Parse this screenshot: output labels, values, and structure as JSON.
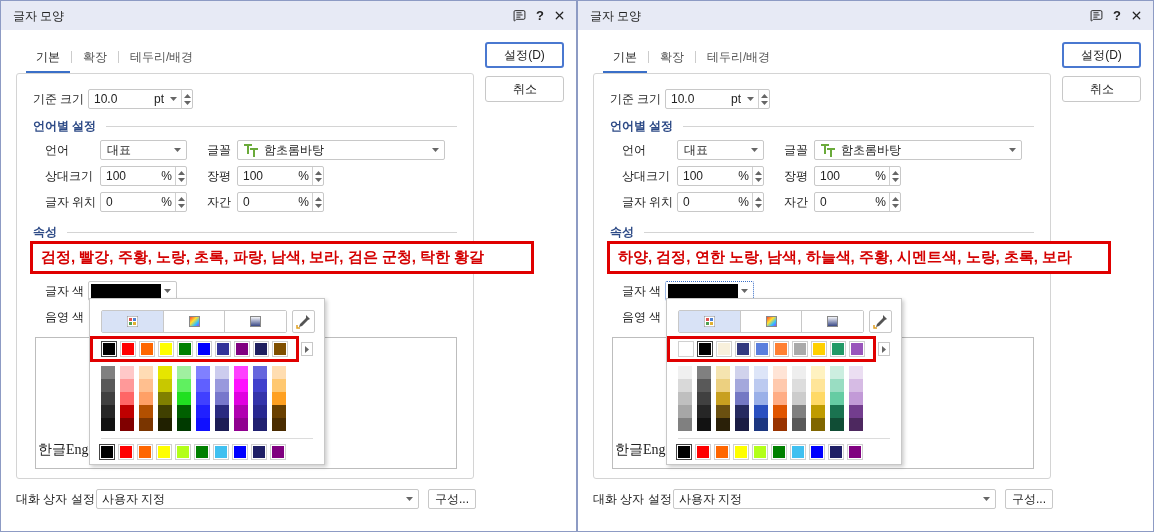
{
  "dialogs": [
    {
      "title": "글자 모양",
      "help": "?",
      "tabs": [
        {
          "label": "기본",
          "selected": true
        },
        {
          "label": "확장",
          "selected": false
        },
        {
          "label": "테두리/배경",
          "selected": false
        }
      ],
      "buttons": [
        {
          "label": "설정(D)",
          "kind": "default"
        },
        {
          "label": "취소",
          "kind": "normal"
        }
      ],
      "base_size": {
        "label": "기준 크기",
        "value": "10.0",
        "unit": "pt"
      },
      "language_section": {
        "title": "언어별 설정",
        "rows": [
          [
            {
              "label": "언어",
              "kind": "select",
              "value": "대표"
            },
            {
              "label": "글꼴",
              "kind": "font_select",
              "value": "함초롬바탕"
            }
          ],
          [
            {
              "label": "상대크기",
              "kind": "spin",
              "value": "100",
              "unit": "%"
            },
            {
              "label": "장평",
              "kind": "spin",
              "value": "100",
              "unit": "%"
            }
          ],
          [
            {
              "label": "글자 위치",
              "kind": "spin",
              "value": "0",
              "unit": "%"
            },
            {
              "label": "자간",
              "kind": "spin",
              "value": "0",
              "unit": "%"
            }
          ]
        ]
      },
      "attributes_section": {
        "title": "속성"
      },
      "annotation": "검정, 빨강, 주황, 노랑, 초록, 파랑, 남색, 보라, 검은 군청, 탁한 황갈",
      "text_color": {
        "label": "글자 색",
        "color": "#000000",
        "focused": false
      },
      "shade_color": {
        "label": "음영 색"
      },
      "preview": "한글Eng",
      "palette": {
        "modes": [
          {
            "kind": "swatches",
            "selected": true
          },
          {
            "kind": "spectrum",
            "selected": false
          },
          {
            "kind": "gradient",
            "selected": false
          }
        ],
        "theme": [
          {
            "color": "#000000",
            "selected": true,
            "shades": [
              {
                "color": "#808080"
              },
              {
                "color": "#595959"
              },
              {
                "color": "#404040"
              },
              {
                "color": "#262626"
              },
              {
                "color": "#121212"
              }
            ]
          },
          {
            "color": "#ff0000",
            "selected": false,
            "shades": [
              {
                "color": "#ffc8c8"
              },
              {
                "color": "#ff9999"
              },
              {
                "color": "#ff6666"
              },
              {
                "color": "#c00000"
              },
              {
                "color": "#800000"
              }
            ]
          },
          {
            "color": "#ff6600",
            "selected": false,
            "shades": [
              {
                "color": "#ffdcb4"
              },
              {
                "color": "#ffbf8f"
              },
              {
                "color": "#ffa066"
              },
              {
                "color": "#b35000"
              },
              {
                "color": "#7a3500"
              }
            ]
          },
          {
            "color": "#ffff00",
            "selected": false,
            "shades": [
              {
                "color": "#e6e600"
              },
              {
                "color": "#c8c800"
              },
              {
                "color": "#808000"
              },
              {
                "color": "#404000"
              },
              {
                "color": "#202000"
              }
            ]
          },
          {
            "color": "#008000",
            "selected": false,
            "shades": [
              {
                "color": "#a0f0a0"
              },
              {
                "color": "#60f060"
              },
              {
                "color": "#20e020"
              },
              {
                "color": "#006000"
              },
              {
                "color": "#003a00"
              }
            ]
          },
          {
            "color": "#0000ff",
            "selected": false,
            "shades": [
              {
                "color": "#8080ff"
              },
              {
                "color": "#6060ff"
              },
              {
                "color": "#4040ff"
              },
              {
                "color": "#2020ff"
              },
              {
                "color": "#1010ff"
              }
            ]
          },
          {
            "color": "#333399",
            "selected": false,
            "shades": [
              {
                "color": "#ccccee"
              },
              {
                "color": "#9999dd"
              },
              {
                "color": "#7777cc"
              },
              {
                "color": "#2a2a80"
              },
              {
                "color": "#1c1c55"
              }
            ]
          },
          {
            "color": "#800080",
            "selected": false,
            "shades": [
              {
                "color": "#ff40ff"
              },
              {
                "color": "#ff10ff"
              },
              {
                "color": "#e000e0"
              },
              {
                "color": "#b000b0"
              },
              {
                "color": "#900090"
              }
            ]
          },
          {
            "color": "#1f1f5f",
            "selected": false,
            "shades": [
              {
                "color": "#6666dd"
              },
              {
                "color": "#4040cc"
              },
              {
                "color": "#3333aa"
              },
              {
                "color": "#282890"
              },
              {
                "color": "#202070"
              }
            ]
          },
          {
            "color": "#7f4f00",
            "selected": false,
            "shades": [
              {
                "color": "#ffddb0"
              },
              {
                "color": "#ffc870"
              },
              {
                "color": "#ffa020"
              },
              {
                "color": "#6a4000"
              },
              {
                "color": "#4a2c00"
              }
            ]
          }
        ],
        "standard": [
          {
            "color": "#000000",
            "selected": true
          },
          {
            "color": "#ff0000",
            "selected": false
          },
          {
            "color": "#ff6600",
            "selected": false
          },
          {
            "color": "#ffff00",
            "selected": false
          },
          {
            "color": "#b3ff1a",
            "selected": false
          },
          {
            "color": "#008000",
            "selected": false
          },
          {
            "color": "#40c0f0",
            "selected": false
          },
          {
            "color": "#0000ff",
            "selected": false
          },
          {
            "color": "#1f1f66",
            "selected": false
          },
          {
            "color": "#800080",
            "selected": false
          }
        ]
      },
      "dialog_settings": {
        "label": "대화 상자 설정",
        "value": "사용자 지정",
        "button": "구성..."
      }
    },
    {
      "title": "글자 모양",
      "help": "?",
      "tabs": [
        {
          "label": "기본",
          "selected": true
        },
        {
          "label": "확장",
          "selected": false
        },
        {
          "label": "테두리/배경",
          "selected": false
        }
      ],
      "buttons": [
        {
          "label": "설정(D)",
          "kind": "default"
        },
        {
          "label": "취소",
          "kind": "normal"
        }
      ],
      "base_size": {
        "label": "기준 크기",
        "value": "10.0",
        "unit": "pt"
      },
      "language_section": {
        "title": "언어별 설정",
        "rows": [
          [
            {
              "label": "언어",
              "kind": "select",
              "value": "대표"
            },
            {
              "label": "글꼴",
              "kind": "font_select",
              "value": "함초롬바탕"
            }
          ],
          [
            {
              "label": "상대크기",
              "kind": "spin",
              "value": "100",
              "unit": "%"
            },
            {
              "label": "장평",
              "kind": "spin",
              "value": "100",
              "unit": "%"
            }
          ],
          [
            {
              "label": "글자 위치",
              "kind": "spin",
              "value": "0",
              "unit": "%"
            },
            {
              "label": "자간",
              "kind": "spin",
              "value": "0",
              "unit": "%"
            }
          ]
        ]
      },
      "attributes_section": {
        "title": "속성"
      },
      "annotation": "하양, 검정, 연한 노랑, 남색, 하늘색, 주황, 시멘트색, 노랑, 초록, 보라",
      "text_color": {
        "label": "글자 색",
        "color": "#000000",
        "focused": true
      },
      "shade_color": {
        "label": "음영 색"
      },
      "preview": "한글Eng",
      "palette": {
        "modes": [
          {
            "kind": "swatches",
            "selected": true
          },
          {
            "kind": "spectrum",
            "selected": false
          },
          {
            "kind": "gradient",
            "selected": false
          }
        ],
        "theme": [
          {
            "color": "#ffffff",
            "selected": false,
            "shades": [
              {
                "color": "#f0f0f0"
              },
              {
                "color": "#d9d9d9"
              },
              {
                "color": "#bfbfbf"
              },
              {
                "color": "#a6a6a6"
              },
              {
                "color": "#808080"
              }
            ]
          },
          {
            "color": "#000000",
            "selected": true,
            "shades": [
              {
                "color": "#808080"
              },
              {
                "color": "#595959"
              },
              {
                "color": "#404040"
              },
              {
                "color": "#262626"
              },
              {
                "color": "#121212"
              }
            ]
          },
          {
            "color": "#f8f0dc",
            "selected": false,
            "shades": [
              {
                "color": "#f5e4b0"
              },
              {
                "color": "#ecd080"
              },
              {
                "color": "#c8a020"
              },
              {
                "color": "#6a5010"
              },
              {
                "color": "#2a2008"
              }
            ]
          },
          {
            "color": "#333a80",
            "selected": false,
            "shades": [
              {
                "color": "#d0d2ec"
              },
              {
                "color": "#a4a8dc"
              },
              {
                "color": "#7478c4"
              },
              {
                "color": "#262a60"
              },
              {
                "color": "#1a1c44"
              }
            ]
          },
          {
            "color": "#5b7fdd",
            "selected": false,
            "shades": [
              {
                "color": "#dde5f8"
              },
              {
                "color": "#bccaf0"
              },
              {
                "color": "#9ab0e8"
              },
              {
                "color": "#2a50c0"
              },
              {
                "color": "#1c3680"
              }
            ]
          },
          {
            "color": "#ff8033",
            "selected": false,
            "shades": [
              {
                "color": "#ffe4d6"
              },
              {
                "color": "#ffc9ad"
              },
              {
                "color": "#ffad85"
              },
              {
                "color": "#e05500"
              },
              {
                "color": "#993300"
              }
            ]
          },
          {
            "color": "#aaaaaa",
            "selected": false,
            "shades": [
              {
                "color": "#eeeeee"
              },
              {
                "color": "#dddddd"
              },
              {
                "color": "#cccccc"
              },
              {
                "color": "#808080"
              },
              {
                "color": "#595959"
              }
            ]
          },
          {
            "color": "#ffd000",
            "selected": false,
            "shades": [
              {
                "color": "#fff2c0"
              },
              {
                "color": "#ffe599"
              },
              {
                "color": "#ffd966"
              },
              {
                "color": "#bf9b00"
              },
              {
                "color": "#806600"
              }
            ]
          },
          {
            "color": "#229966",
            "selected": false,
            "shades": [
              {
                "color": "#cceee0"
              },
              {
                "color": "#99ddc2"
              },
              {
                "color": "#66cca3"
              },
              {
                "color": "#1a7350"
              },
              {
                "color": "#104d35"
              }
            ]
          },
          {
            "color": "#9955bb",
            "selected": false,
            "shades": [
              {
                "color": "#ebdef2"
              },
              {
                "color": "#d6bbe4"
              },
              {
                "color": "#c29ad7"
              },
              {
                "color": "#733d8e"
              },
              {
                "color": "#4d285f"
              }
            ]
          }
        ],
        "standard": [
          {
            "color": "#000000",
            "selected": true
          },
          {
            "color": "#ff0000",
            "selected": false
          },
          {
            "color": "#ff6600",
            "selected": false
          },
          {
            "color": "#ffff00",
            "selected": false
          },
          {
            "color": "#b3ff1a",
            "selected": false
          },
          {
            "color": "#008000",
            "selected": false
          },
          {
            "color": "#40c0f0",
            "selected": false
          },
          {
            "color": "#0000ff",
            "selected": false
          },
          {
            "color": "#1f1f66",
            "selected": false
          },
          {
            "color": "#800080",
            "selected": false
          }
        ]
      },
      "dialog_settings": {
        "label": "대화 상자 설정",
        "value": "사용자 지정",
        "button": "구성..."
      }
    }
  ]
}
